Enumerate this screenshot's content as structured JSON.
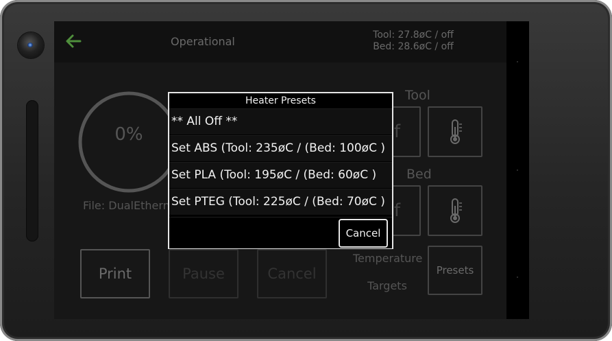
{
  "actionbar": {
    "back_icon": "arrow-left-icon",
    "status": "Operational",
    "tool_temp": "Tool: 27.8øC / off",
    "bed_temp": "Bed: 28.6øC / off"
  },
  "job": {
    "progress_percent": 0,
    "progress_label": "0%",
    "file_label": "File: DualEtherne"
  },
  "controls": {
    "print": "Print",
    "pause": "Pause",
    "cancel": "Cancel"
  },
  "heaters": {
    "tool_label": "Tool",
    "bed_label": "Bed",
    "tool_state_partial": "f",
    "bed_state_partial": "f",
    "thermometer_icon": "thermometer-icon",
    "targets_line1": "Temperature",
    "targets_line2": "Targets",
    "presets": "Presets"
  },
  "dialog": {
    "title": "Heater Presets",
    "items": [
      "** All Off **",
      "Set ABS (Tool: 235øC  / (Bed: 100øC )",
      "Set PLA (Tool: 195øC  / (Bed: 60øC )",
      "Set PTEG (Tool: 225øC  / (Bed: 70øC )"
    ],
    "cancel": "Cancel"
  },
  "colors": {
    "accent_green": "#4f8f3c",
    "dialog_border": "#e6e6e6",
    "screen_bg": "#171717"
  }
}
